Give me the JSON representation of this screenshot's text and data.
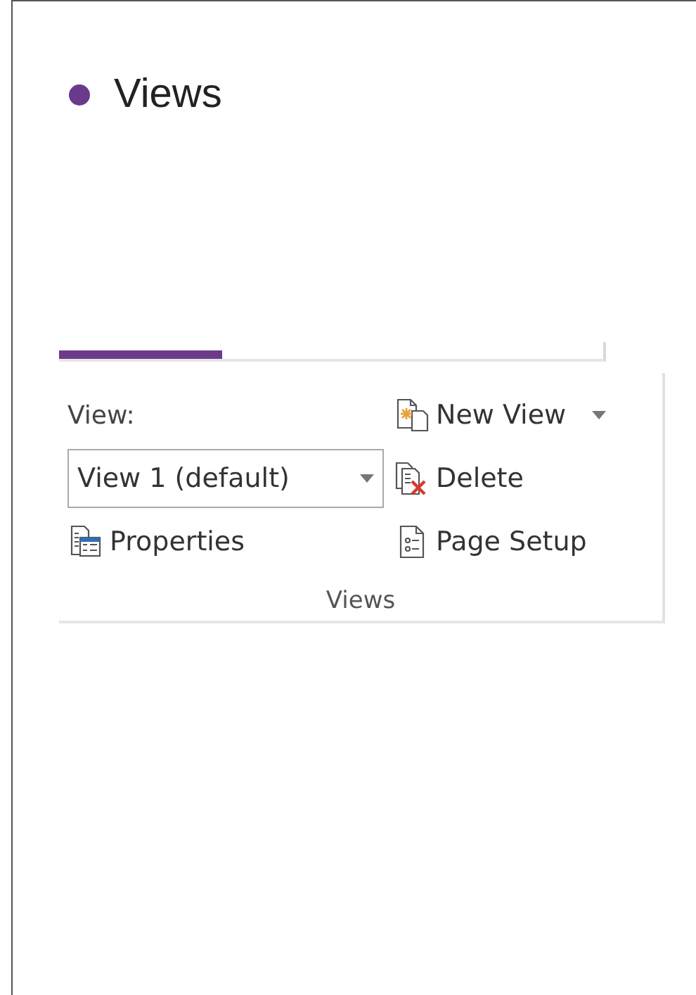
{
  "heading": {
    "title": "Views",
    "color": "#6a3a8c"
  },
  "progress": {
    "level": 0.3
  },
  "ribbon_group": {
    "label": "Views",
    "view_label": "View:",
    "view_dropdown": {
      "value": "View 1 (default)"
    },
    "buttons": [
      {
        "kind": "new",
        "label": "New View",
        "dropdown": true
      },
      {
        "kind": "delete",
        "label": "Delete",
        "dropdown": false
      },
      {
        "kind": "properties",
        "label": "Properties",
        "dropdown": false
      },
      {
        "kind": "setup",
        "label": "Page Setup",
        "dropdown": false
      }
    ]
  }
}
